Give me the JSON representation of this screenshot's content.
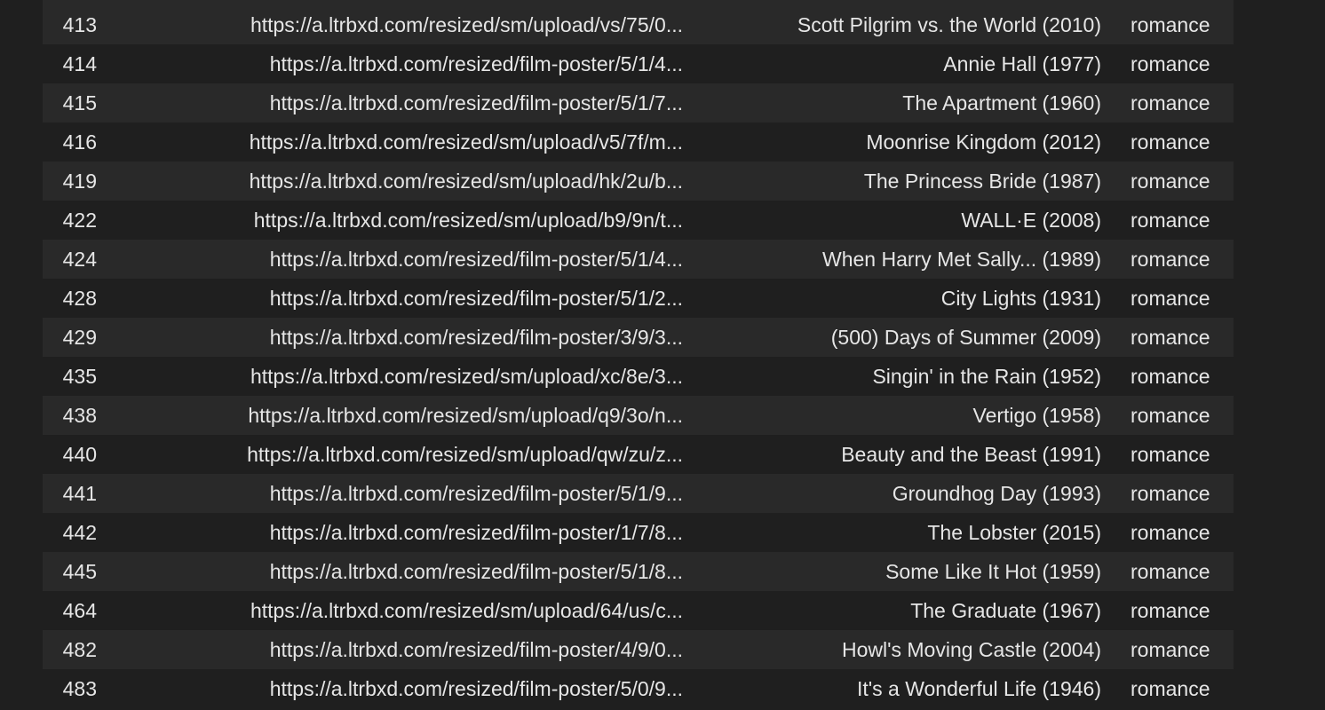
{
  "table": {
    "rows": [
      {
        "index": "413",
        "poster_url": "https://a.ltrbxd.com/resized/sm/upload/vs/75/0...",
        "title": "Scott Pilgrim vs. the World (2010)",
        "genre": "romance"
      },
      {
        "index": "414",
        "poster_url": "https://a.ltrbxd.com/resized/film-poster/5/1/4...",
        "title": "Annie Hall (1977)",
        "genre": "romance"
      },
      {
        "index": "415",
        "poster_url": "https://a.ltrbxd.com/resized/film-poster/5/1/7...",
        "title": "The Apartment (1960)",
        "genre": "romance"
      },
      {
        "index": "416",
        "poster_url": "https://a.ltrbxd.com/resized/sm/upload/v5/7f/m...",
        "title": "Moonrise Kingdom (2012)",
        "genre": "romance"
      },
      {
        "index": "419",
        "poster_url": "https://a.ltrbxd.com/resized/sm/upload/hk/2u/b...",
        "title": "The Princess Bride (1987)",
        "genre": "romance"
      },
      {
        "index": "422",
        "poster_url": "https://a.ltrbxd.com/resized/sm/upload/b9/9n/t...",
        "title": "WALL·E (2008)",
        "genre": "romance"
      },
      {
        "index": "424",
        "poster_url": "https://a.ltrbxd.com/resized/film-poster/5/1/4...",
        "title": "When Harry Met Sally... (1989)",
        "genre": "romance"
      },
      {
        "index": "428",
        "poster_url": "https://a.ltrbxd.com/resized/film-poster/5/1/2...",
        "title": "City Lights (1931)",
        "genre": "romance"
      },
      {
        "index": "429",
        "poster_url": "https://a.ltrbxd.com/resized/film-poster/3/9/3...",
        "title": "(500) Days of Summer (2009)",
        "genre": "romance"
      },
      {
        "index": "435",
        "poster_url": "https://a.ltrbxd.com/resized/sm/upload/xc/8e/3...",
        "title": "Singin' in the Rain (1952)",
        "genre": "romance"
      },
      {
        "index": "438",
        "poster_url": "https://a.ltrbxd.com/resized/sm/upload/q9/3o/n...",
        "title": "Vertigo (1958)",
        "genre": "romance"
      },
      {
        "index": "440",
        "poster_url": "https://a.ltrbxd.com/resized/sm/upload/qw/zu/z...",
        "title": "Beauty and the Beast (1991)",
        "genre": "romance"
      },
      {
        "index": "441",
        "poster_url": "https://a.ltrbxd.com/resized/film-poster/5/1/9...",
        "title": "Groundhog Day (1993)",
        "genre": "romance"
      },
      {
        "index": "442",
        "poster_url": "https://a.ltrbxd.com/resized/film-poster/1/7/8...",
        "title": "The Lobster (2015)",
        "genre": "romance"
      },
      {
        "index": "445",
        "poster_url": "https://a.ltrbxd.com/resized/film-poster/5/1/8...",
        "title": "Some Like It Hot (1959)",
        "genre": "romance"
      },
      {
        "index": "464",
        "poster_url": "https://a.ltrbxd.com/resized/sm/upload/64/us/c...",
        "title": "The Graduate (1967)",
        "genre": "romance"
      },
      {
        "index": "482",
        "poster_url": "https://a.ltrbxd.com/resized/film-poster/4/9/0...",
        "title": "Howl's Moving Castle (2004)",
        "genre": "romance"
      },
      {
        "index": "483",
        "poster_url": "https://a.ltrbxd.com/resized/film-poster/5/0/9...",
        "title": "It's a Wonderful Life (1946)",
        "genre": "romance"
      }
    ]
  }
}
